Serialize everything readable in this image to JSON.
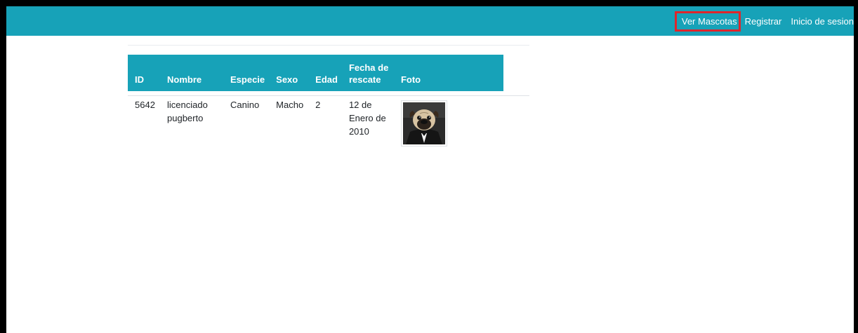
{
  "navbar": {
    "links": [
      {
        "label": "Ver Mascotas",
        "highlighted": true
      },
      {
        "label": "Registrar",
        "highlighted": false
      },
      {
        "label": "Inicio de sesion",
        "highlighted": false
      }
    ],
    "background_color": "#17a2b8",
    "highlight_color": "#e0252b"
  },
  "table": {
    "headers": {
      "id": "ID",
      "nombre": "Nombre",
      "especie": "Especie",
      "sexo": "Sexo",
      "edad": "Edad",
      "fecha_line1": "Fecha de",
      "fecha_line2": "rescate",
      "foto": "Foto"
    },
    "rows": [
      {
        "id": "5642",
        "nombre_line1": "licenciado",
        "nombre_line2": "pugberto",
        "especie": "Canino",
        "sexo": "Macho",
        "edad": "2",
        "fecha_line1": "12 de",
        "fecha_line2": "Enero de",
        "fecha_line3": "2010",
        "foto": "pug-photo"
      }
    ]
  }
}
